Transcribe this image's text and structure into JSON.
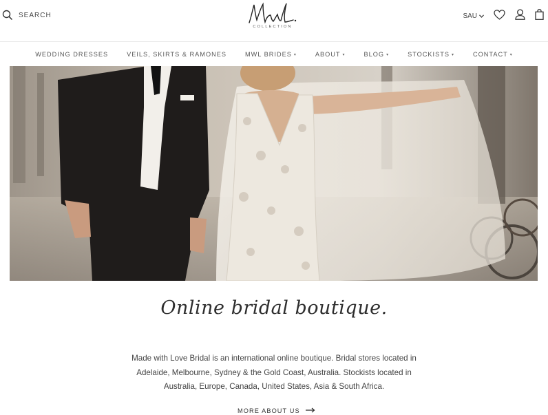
{
  "header": {
    "search_label": "SEARCH",
    "logo_script": "MwL.",
    "logo_subtitle": "COLLECTION",
    "currency": "SAU"
  },
  "nav": {
    "items": [
      {
        "label": "WEDDING DRESSES",
        "has_menu": false
      },
      {
        "label": "VEILS, SKIRTS & RAMONES",
        "has_menu": false
      },
      {
        "label": "MWL BRIDES",
        "has_menu": true
      },
      {
        "label": "ABOUT",
        "has_menu": true
      },
      {
        "label": "BLOG",
        "has_menu": true
      },
      {
        "label": "STOCKISTS",
        "has_menu": true
      },
      {
        "label": "CONTACT",
        "has_menu": true
      }
    ]
  },
  "main": {
    "tagline": "Online bridal boutique.",
    "description": "Made with Love Bridal is an international online boutique. Bridal stores located in Adelaide, Melbourne, Sydney & the Gold Coast, Australia. Stockists located in Australia, Europe, Canada, United States, Asia & South Africa.",
    "more_link": "MORE ABOUT US"
  },
  "icons": {
    "search": "search-icon",
    "currency_caret": "chevron-down-icon",
    "wishlist": "heart-icon",
    "account": "user-icon",
    "cart": "shopping-bag-icon",
    "more_arrow": "arrow-right-icon"
  }
}
